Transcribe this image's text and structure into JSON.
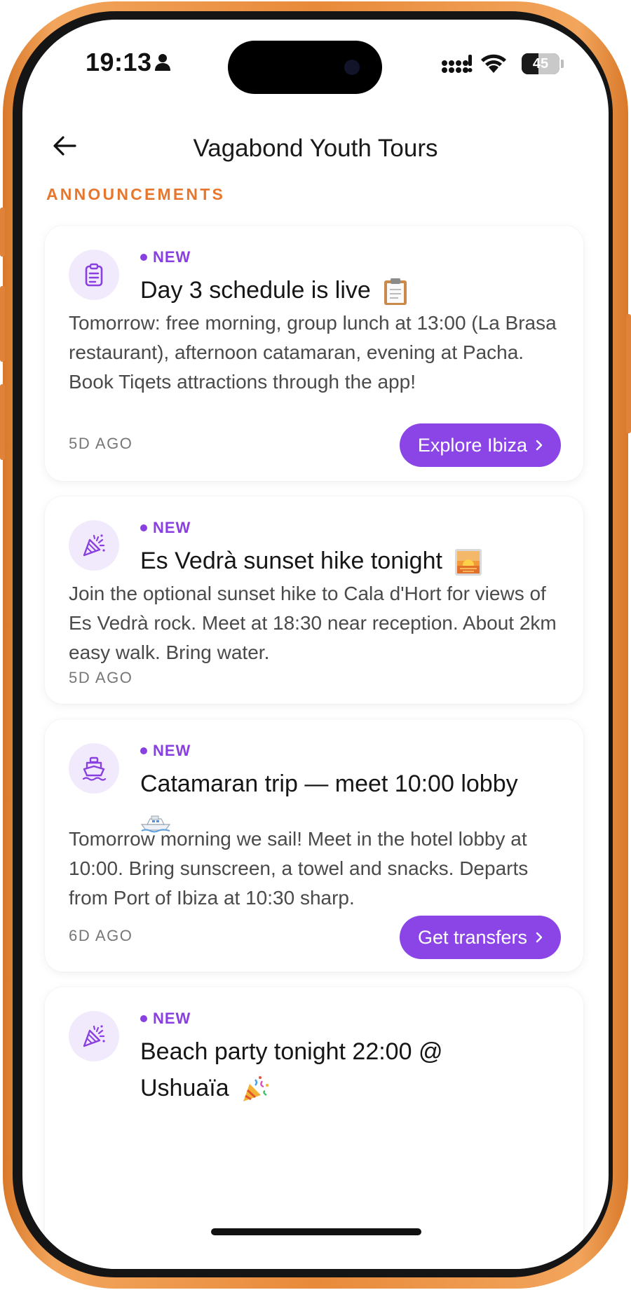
{
  "status_bar": {
    "time": "19:13",
    "battery_level": "45",
    "battery_fraction": 0.45
  },
  "header": {
    "title": "Vagabond Youth Tours"
  },
  "section": {
    "label": "ANNOUNCEMENTS"
  },
  "announcements": [
    {
      "icon": "clipboard-icon",
      "badge": "NEW",
      "title": "Day 3 schedule is live",
      "emoji_icon": "clipboard-emoji",
      "body": "Tomorrow: free morning, group lunch at 13:00 (La Brasa restaurant), afternoon catamaran, evening at Pacha. Book Tiqets attractions through the app!",
      "time_ago": "5D AGO",
      "cta": "Explore Ibiza"
    },
    {
      "icon": "party-popper-icon",
      "badge": "NEW",
      "title": "Es Vedrà sunset hike tonight",
      "emoji_icon": "sunset-emoji",
      "body": "Join the optional sunset hike to Cala d'Hort for views of Es Vedrà rock. Meet at 18:30 near reception. About 2km easy walk. Bring water.",
      "time_ago": "5D AGO",
      "cta": ""
    },
    {
      "icon": "ship-icon",
      "badge": "NEW",
      "title": "Catamaran trip — meet 10:00 lobby",
      "emoji_icon": "boat-emoji",
      "body": "Tomorrow morning we sail! Meet in the hotel lobby at 10:00. Bring sunscreen, a towel and snacks. Departs from Port of Ibiza at 10:30 sharp.",
      "time_ago": "6D AGO",
      "cta": "Get transfers"
    },
    {
      "icon": "party-popper-icon",
      "badge": "NEW",
      "title": "Beach party tonight 22:00 @ Ushuaïa",
      "emoji_icon": "party-popper-emoji",
      "body": "",
      "time_ago": "",
      "cta": ""
    }
  ],
  "colors": {
    "accent_purple": "#8b45e6",
    "section_orange": "#e8772e",
    "icon_bg": "#f1eafd",
    "frame_orange": "#e88a3a"
  }
}
